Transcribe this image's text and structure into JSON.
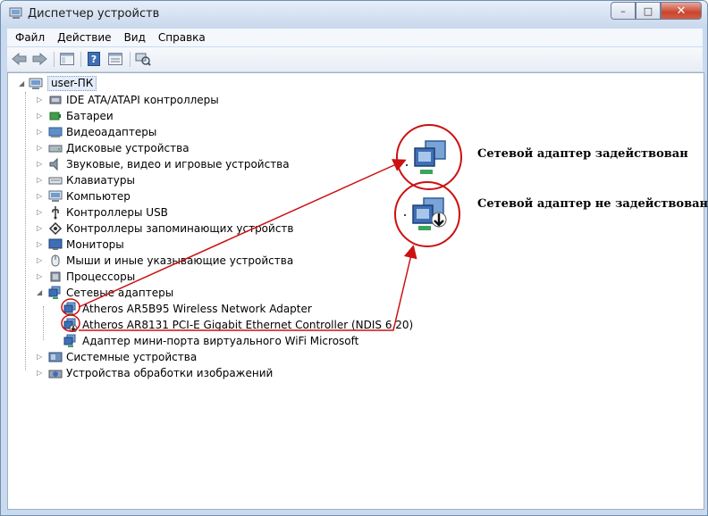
{
  "window": {
    "title": "Диспетчер устройств"
  },
  "window_buttons": {
    "minimize": "–",
    "maximize": "□",
    "close": "✕"
  },
  "menu": {
    "file": "Файл",
    "action": "Действие",
    "view": "Вид",
    "help": "Справка"
  },
  "tree": {
    "root": "user-ПК",
    "categories": [
      "IDE ATA/ATAPI контроллеры",
      "Батареи",
      "Видеоадаптеры",
      "Дисковые устройства",
      "Звуковые, видео и игровые устройства",
      "Клавиатуры",
      "Компьютер",
      "Контроллеры USB",
      "Контроллеры запоминающих устройств",
      "Мониторы",
      "Мыши и иные указывающие устройства",
      "Процессоры",
      "Сетевые адаптеры"
    ],
    "network_adapters": [
      "Atheros AR5B95 Wireless Network Adapter",
      "Atheros AR8131 PCI-E Gigabit Ethernet Controller (NDIS 6.20)",
      "Адаптер мини-порта виртуального WiFi Microsoft"
    ],
    "categories_after": [
      "Системные устройства",
      "Устройства обработки изображений"
    ]
  },
  "annotations": {
    "enabled": "Сетевой адаптер задействован",
    "disabled": "Сетевой адаптер не задействован",
    "color": "#cc1111"
  }
}
